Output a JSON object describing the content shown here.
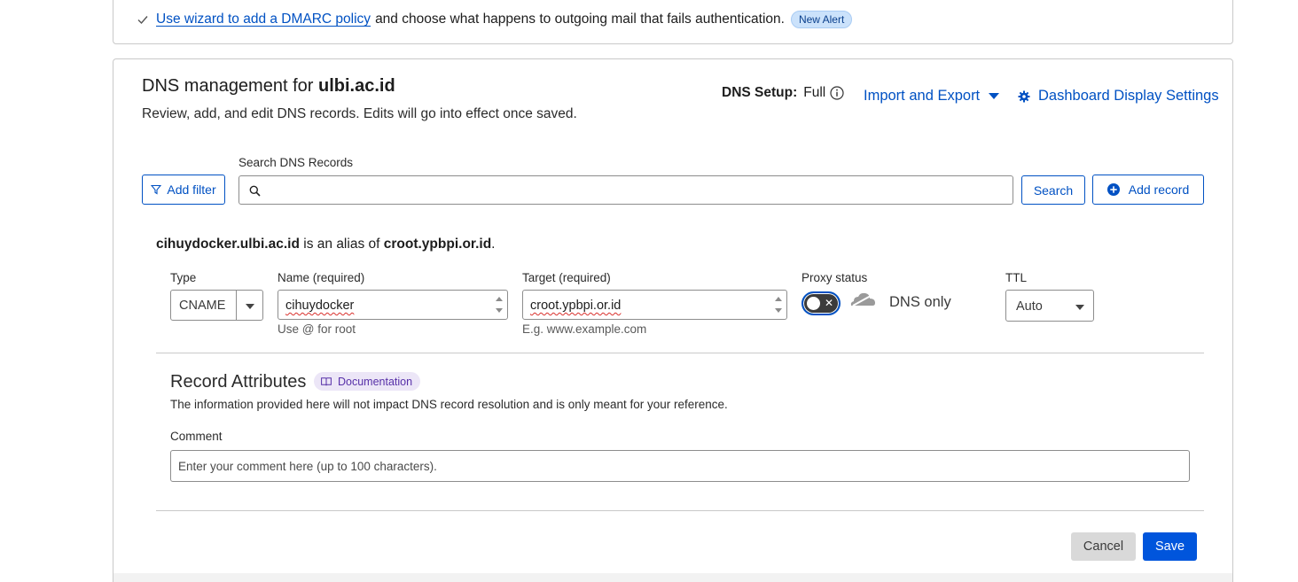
{
  "alert": {
    "link_text": "Use wizard to add a DMARC policy",
    "rest_text": "and choose what happens to outgoing mail that fails authentication.",
    "badge": "New Alert"
  },
  "dns": {
    "title_prefix": "DNS management for",
    "domain": "ulbi.ac.id",
    "subtitle": "Review, add, and edit DNS records. Edits will go into effect once saved.",
    "setup_label": "DNS Setup:",
    "setup_value": "Full",
    "import_export": "Import and Export",
    "dashboard_settings": "Dashboard Display Settings"
  },
  "search": {
    "filter_button": "Add filter",
    "label": "Search DNS Records",
    "placeholder": "",
    "search_button": "Search",
    "add_record_button": "Add record"
  },
  "record": {
    "alias_name": "cihuydocker.ulbi.ac.id",
    "alias_middle": "is an alias of",
    "alias_target": "croot.ypbpi.or.id",
    "alias_end": ".",
    "type_label": "Type",
    "type_value": "CNAME",
    "name_label": "Name (required)",
    "name_value": "cihuydocker",
    "name_hint": "Use @ for root",
    "target_label": "Target (required)",
    "target_value": "croot.ypbpi.or.id",
    "target_hint": "E.g. www.example.com",
    "proxy_label": "Proxy status",
    "proxy_status": "DNS only",
    "proxy_enabled": false,
    "ttl_label": "TTL",
    "ttl_value": "Auto"
  },
  "attributes": {
    "title": "Record Attributes",
    "doc_badge": "Documentation",
    "description": "The information provided here will not impact DNS record resolution and is only meant for your reference.",
    "comment_label": "Comment",
    "comment_placeholder": "Enter your comment here (up to 100 characters)."
  },
  "actions": {
    "cancel": "Cancel",
    "save": "Save"
  },
  "colors": {
    "link_blue": "#0051c3",
    "save_blue": "#0055dc",
    "badge_blue_bg": "#cbe2fb",
    "doc_badge_bg": "#ece6f7",
    "border": "#c9c9c9"
  }
}
